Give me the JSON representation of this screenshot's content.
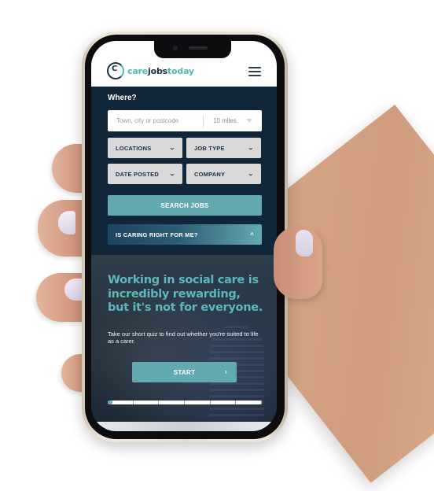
{
  "site": {
    "logo": {
      "care": "care",
      "jobs": "jobs",
      "today": "today"
    },
    "menu_icon": "hamburger-icon"
  },
  "search": {
    "where_label": "Where?",
    "location_placeholder": "Town, city or postcode",
    "location_value": "",
    "radius_value": "10 miles",
    "filters": [
      {
        "label": "LOCATIONS"
      },
      {
        "label": "JOB TYPE"
      },
      {
        "label": "DATE POSTED"
      },
      {
        "label": "COMPANY"
      }
    ],
    "chevron": "⌄",
    "search_button": "SEARCH JOBS"
  },
  "quiz": {
    "toggle_label": "IS CARING RIGHT FOR ME?",
    "toggle_state": "expanded",
    "title": "Working in social care is incredibly rewarding, but it's not for everyone.",
    "subtitle": "Take our short quiz to find out whether you're suited to life as a carer.",
    "start_button": "START",
    "progress": {
      "current_step": 0,
      "total_steps": 6,
      "fraction": 0.02
    }
  },
  "colors": {
    "brand_teal": "#62aab0",
    "brand_navy": "#12263a",
    "title_teal": "#5fb7bb"
  }
}
